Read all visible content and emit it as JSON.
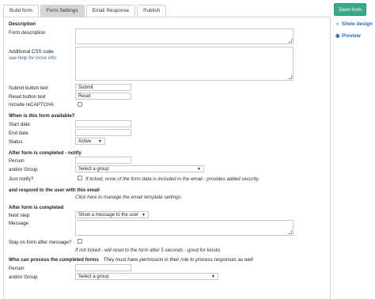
{
  "tabs": [
    {
      "label": "Build form"
    },
    {
      "label": "Form Settings"
    },
    {
      "label": "Email Response"
    },
    {
      "label": "Publish"
    }
  ],
  "sidebar": {
    "save_label": "Save form",
    "show_design": "Show design",
    "preview": "Preview",
    "show_design_icon": "contrast-icon",
    "preview_icon": "eye-icon"
  },
  "description": {
    "heading": "Description",
    "form_description_label": "Form description",
    "css_label": "Additional CSS code",
    "css_help": "see help for more info"
  },
  "buttons": {
    "submit_label": "Submit button text",
    "submit_value": "Submit",
    "reset_label": "Reset button text",
    "reset_value": "Reset",
    "recaptcha_label": "Include reCAPTCHA"
  },
  "availability": {
    "heading": "When is this form available?",
    "start_label": "Start date",
    "end_label": "End date",
    "status_label": "Status",
    "status_value": "Active"
  },
  "notify": {
    "heading": "After form is completed - notify",
    "person_label": "Person",
    "group_label": "and/or Group",
    "group_value": "Select a group",
    "just_notify_label": "Just notify?",
    "just_notify_note": "If ticked, none of the form data is included in the email - provides added security."
  },
  "respond": {
    "heading": "and respond to the user with this email",
    "link": "Click here to manage the email template settings"
  },
  "completed": {
    "heading": "After form is completed",
    "next_step_label": "Next step",
    "next_step_value": "Show a message to the user",
    "message_label": "Message",
    "stay_label": "Stay on form after message?",
    "stay_note": "If not ticked - will reset to the form after 5 seconds - good for kiosks"
  },
  "process": {
    "heading": "Who can process the completed forms",
    "heading_note": "They must have permission in their role to process responses as well",
    "person_label": "Person",
    "group_label": "and/or Group",
    "group_value": "Select a group"
  },
  "colors": {
    "accent": "#3aaa8b",
    "link": "#2b67b0",
    "active_tab": "#d7d7d7"
  }
}
